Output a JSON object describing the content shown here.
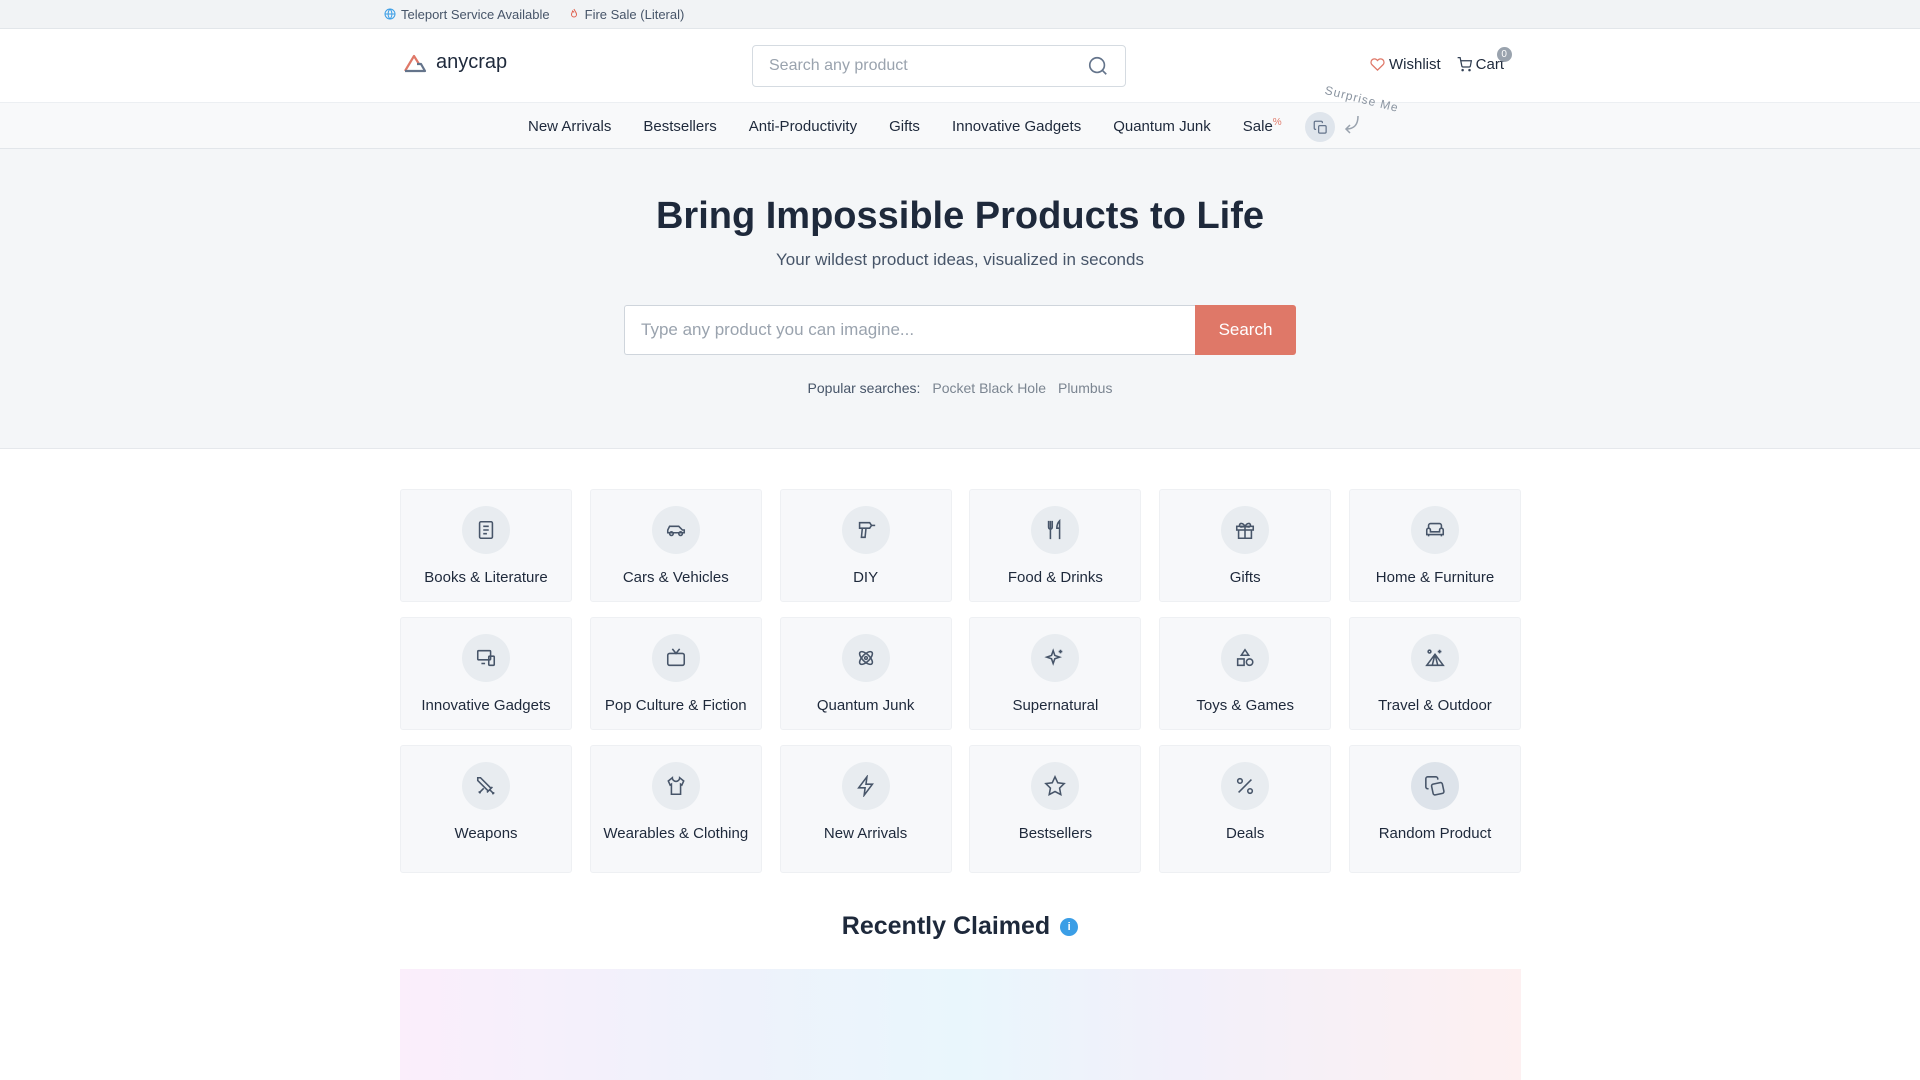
{
  "topbar": {
    "teleport": "Teleport Service Available",
    "fire_sale": "Fire Sale (Literal)"
  },
  "header": {
    "brand": "anycrap",
    "search_placeholder": "Search any product",
    "wishlist": "Wishlist",
    "cart": "Cart",
    "cart_count": "0"
  },
  "nav": {
    "items": [
      "New Arrivals",
      "Bestsellers",
      "Anti-Productivity",
      "Gifts",
      "Innovative Gadgets",
      "Quantum Junk"
    ],
    "sale": "Sale",
    "sale_mark": "%",
    "surprise": "Surprise Me"
  },
  "hero": {
    "title": "Bring Impossible Products to Life",
    "subtitle": "Your wildest product ideas, visualized in seconds",
    "placeholder": "Type any product you can imagine...",
    "button": "Search",
    "popular_label": "Popular searches:",
    "popular": [
      "Pocket Black Hole",
      "Plumbus"
    ]
  },
  "categories": [
    {
      "label": "Books & Literature",
      "icon": "book-icon"
    },
    {
      "label": "Cars & Vehicles",
      "icon": "car-icon"
    },
    {
      "label": "DIY",
      "icon": "drill-icon"
    },
    {
      "label": "Food & Drinks",
      "icon": "utensils-icon"
    },
    {
      "label": "Gifts",
      "icon": "gift-icon"
    },
    {
      "label": "Home & Furniture",
      "icon": "sofa-icon"
    },
    {
      "label": "Innovative Gadgets",
      "icon": "devices-icon"
    },
    {
      "label": "Pop Culture & Fiction",
      "icon": "tv-icon"
    },
    {
      "label": "Quantum Junk",
      "icon": "atom-icon"
    },
    {
      "label": "Supernatural",
      "icon": "sparkles-icon"
    },
    {
      "label": "Toys & Games",
      "icon": "shapes-icon"
    },
    {
      "label": "Travel & Outdoor",
      "icon": "tent-icon"
    },
    {
      "label": "Weapons",
      "icon": "swords-icon"
    },
    {
      "label": "Wearables & Clothing",
      "icon": "shirt-icon"
    },
    {
      "label": "New Arrivals",
      "icon": "zap-icon"
    },
    {
      "label": "Bestsellers",
      "icon": "star-icon"
    },
    {
      "label": "Deals",
      "icon": "percent-icon"
    },
    {
      "label": "Random Product",
      "icon": "dice-icon"
    }
  ],
  "recent": {
    "title": "Recently Claimed",
    "info": "i"
  },
  "colors": {
    "accent": "#df7868",
    "info": "#3b9ee6"
  }
}
